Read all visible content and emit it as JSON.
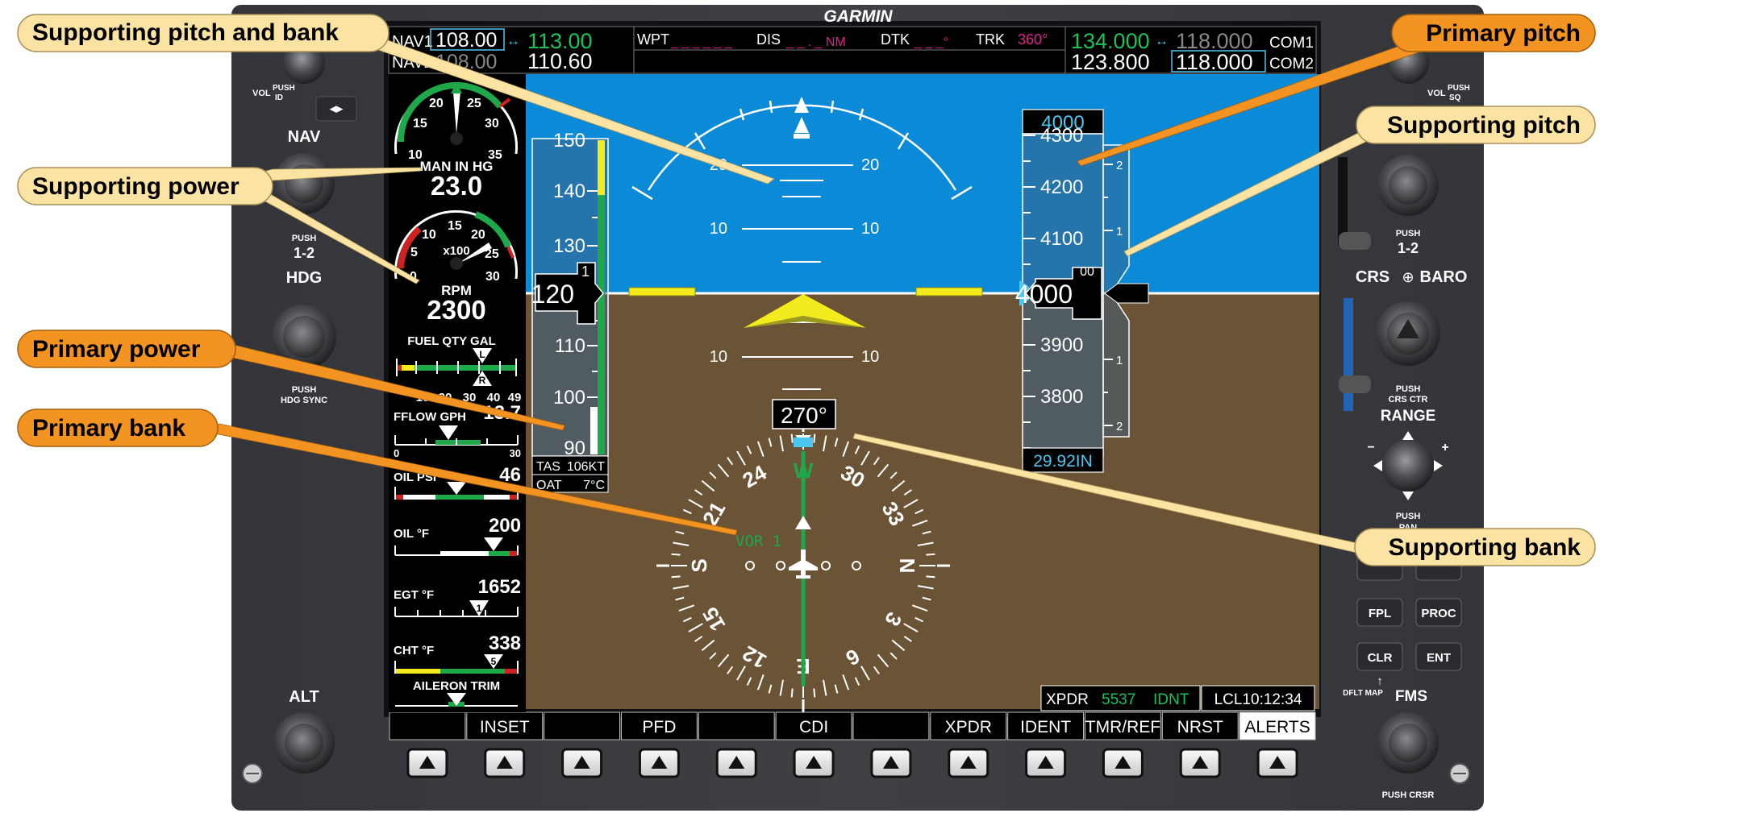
{
  "brand": "GARMIN",
  "nav": {
    "nav1_label": "NAV1",
    "nav2_label": "NAV2",
    "nav1_active": "108.00",
    "nav1_standby": "113.00",
    "nav2_active": "108.00",
    "nav2_standby": "110.60",
    "swap_glyph": "↔"
  },
  "com": {
    "com1_active": "134.000",
    "com1_standby": "118.000",
    "com2_active": "123.800",
    "com2_standby": "118.000",
    "com1_label": "COM1",
    "com2_label": "COM2",
    "swap_glyph": "↔"
  },
  "nav_status": {
    "wpt_label": "WPT",
    "wpt_value": "_ _ _ _ _ _",
    "dis_label": "DIS",
    "dis_value": "_ _ . _ NM",
    "dtk_label": "DTK",
    "dtk_value": "_ _ _°",
    "trk_label": "TRK",
    "trk_value": "360°"
  },
  "left_bezel": {
    "vol_label": "VOL",
    "push_id": "PUSH\nID",
    "nav_label": "NAV",
    "push_12": "PUSH",
    "push_12b": "1-2",
    "hdg_label": "HDG",
    "push_hdg_sync_a": "PUSH",
    "push_hdg_sync_b": "HDG SYNC",
    "alt_label": "ALT",
    "swap_button": "◂▸"
  },
  "right_bezel": {
    "vol_label": "VOL",
    "push_sq": "PUSH\nSQ",
    "push_12": "PUSH",
    "push_12b": "1-2",
    "crs_baro": "CRS",
    "baro": "BARO",
    "push_crs_ctr_a": "PUSH",
    "push_crs_ctr_b": "CRS CTR",
    "range_label": "RANGE",
    "push_pan_a": "PUSH",
    "push_pan_b": "PAN",
    "fpl": "FPL",
    "proc": "PROC",
    "clr": "CLR",
    "ent": "ENT",
    "dflt_map": "DFLT MAP",
    "fms": "FMS",
    "push_crsr": "PUSH CRSR"
  },
  "engine": {
    "man_label": "MAN IN HG",
    "man_value": "23.0",
    "man_ticks": [
      "10",
      "15",
      "20",
      "25",
      "30",
      "35"
    ],
    "rpm_label": "RPM",
    "rpm_value": "2300",
    "rpm_ticks": [
      "0",
      "5",
      "10",
      "15",
      "20",
      "25",
      "30"
    ],
    "rpm_multiplier": "x100",
    "fuel_label": "FUEL QTY GAL",
    "fuel_ticks": [
      "10",
      "20",
      "30",
      "40",
      "49"
    ],
    "fuel_l": "L",
    "fuel_r": "R",
    "fflow_label": "FFLOW GPH",
    "fflow_value": "13.7",
    "fflow_min": "0",
    "fflow_max": "30",
    "oilpsi_label": "OIL PSI",
    "oilpsi_value": "46",
    "oilf_label": "OIL °F",
    "oilf_value": "200",
    "egt_label": "EGT °F",
    "egt_value": "1652",
    "egt_cyl": "1",
    "cht_label": "CHT °F",
    "cht_value": "338",
    "cht_cyl": "5",
    "trim_label": "AILERON TRIM"
  },
  "pfd": {
    "airspeed_ticks": [
      "150",
      "140",
      "130",
      "120",
      "110",
      "100",
      "90"
    ],
    "airspeed_value": "120",
    "airspeed_roll": "1",
    "tas_label": "TAS",
    "tas_value": "106KT",
    "oat_label": "OAT",
    "oat_value": "7°C",
    "pitch_labels": [
      "20",
      "20",
      "10",
      "10",
      "10",
      "10"
    ],
    "altitude_selected": "4000",
    "altitude_ticks": [
      "4300",
      "4200",
      "4100",
      "3900",
      "3800",
      "4000"
    ],
    "altitude_value": "4000",
    "altitude_roll": "00",
    "vsi_ticks": [
      "2",
      "1",
      "1",
      "2"
    ],
    "baro_setting": "29.92IN",
    "heading_value": "270°",
    "nav_source": "VOR 1",
    "compass_labels": [
      "W",
      "24",
      "30",
      "21",
      "33",
      "S",
      "N",
      "15",
      "3",
      "12",
      "6",
      "E"
    ]
  },
  "bottom_status": {
    "xpdr_label": "XPDR",
    "xpdr_code": "5537",
    "xpdr_mode": "IDNT",
    "lcl_time": "LCL10:12:34"
  },
  "softkeys": [
    "",
    "INSET",
    "",
    "PFD",
    "",
    "CDI",
    "",
    "XPDR",
    "IDENT",
    "TMR/REF",
    "NRST",
    "ALERTS"
  ],
  "callouts": {
    "supporting_pitch_and_bank": "Supporting pitch and bank",
    "supporting_power": "Supporting power",
    "primary_power": "Primary power",
    "primary_bank": "Primary bank",
    "primary_pitch": "Primary pitch",
    "supporting_pitch": "Supporting pitch",
    "supporting_bank": "Supporting bank"
  },
  "colors": {
    "bezel": "#3a3b3e",
    "sky": "#0b8ad8",
    "ground": "#6a5435",
    "green_freq": "#19c25a",
    "magenta": "#e0208c",
    "cyan": "#4cc7ef",
    "callout_orange": "#f39322",
    "callout_cream": "#fbe3a4"
  }
}
